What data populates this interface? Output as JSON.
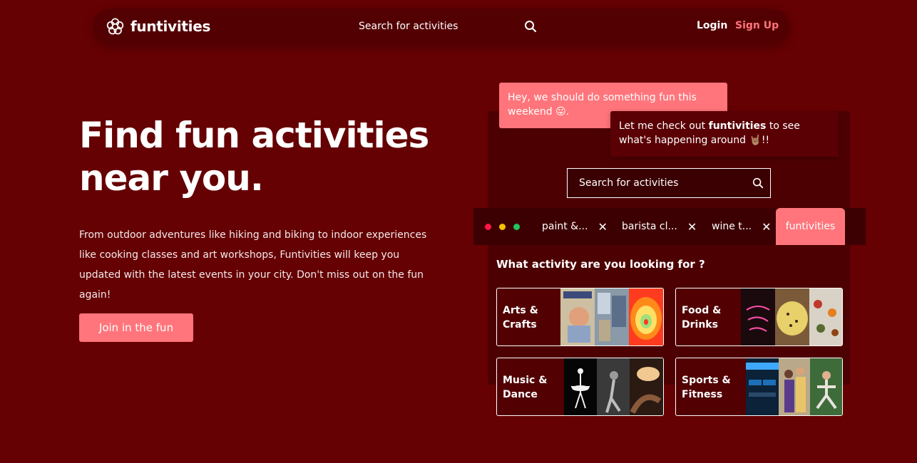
{
  "colors": {
    "background": "#650003",
    "accent": "#ff757b",
    "navbar": "#530002",
    "panel": "#4d0002"
  },
  "nav": {
    "brand": "funtivities",
    "brand_icon": "flower-icon",
    "search_placeholder": "Search for activities",
    "search_icon": "search-icon",
    "login": "Login",
    "signup": "Sign Up"
  },
  "hero": {
    "title_line1": "Find fun activities",
    "title_line2": "near you.",
    "description": "From outdoor adventures like hiking and biking to indoor experiences like cooking classes and art workshops, Funtivities will keep you updated with the latest events in your city. Don't miss out on the fun again!",
    "cta": "Join in the fun"
  },
  "chat": {
    "message1": "Hey, we should do something fun this weekend 😛.",
    "message2_prefix": "Let me check out ",
    "message2_bold": "funtivities",
    "message2_suffix": " to see what's happening around 🤘🏽!!"
  },
  "mock": {
    "search_placeholder": "Search for activities",
    "tabs": [
      {
        "label": "paint &..."
      },
      {
        "label": "barista cl..."
      },
      {
        "label": "wine t..."
      }
    ],
    "active_tab": "funtivities",
    "question": "What activity are you looking for ?",
    "categories": [
      {
        "line1": "Arts &",
        "line2": "Crafts"
      },
      {
        "line1": "Food &",
        "line2": "Drinks"
      },
      {
        "line1": "Music &",
        "line2": "Dance"
      },
      {
        "line1": "Sports &",
        "line2": "Fitness"
      }
    ]
  }
}
